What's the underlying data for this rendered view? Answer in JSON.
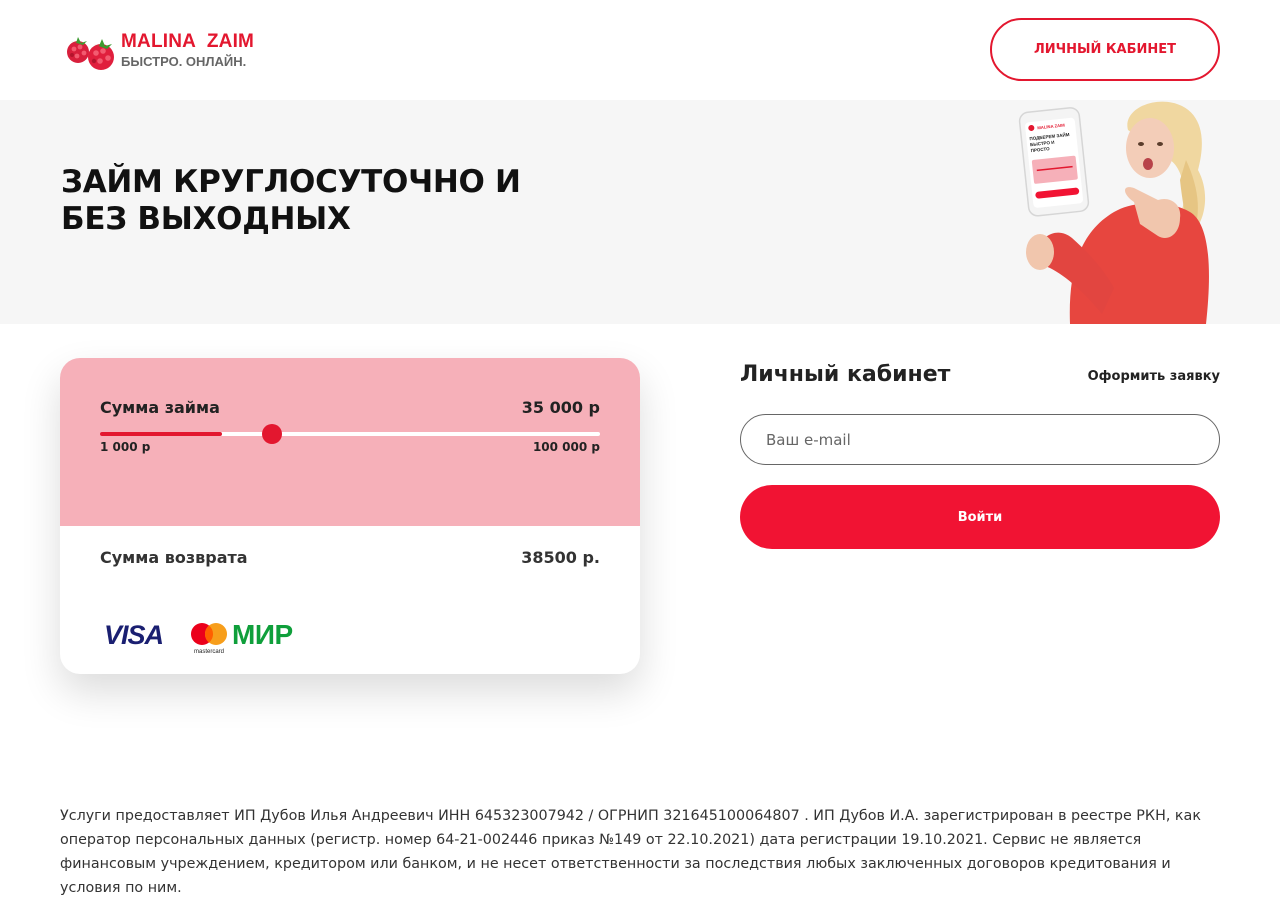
{
  "header": {
    "brand_name": "MALINA ZAIM",
    "brand_tagline": "БЫСТРО. ОНЛАЙН.",
    "cabinet_button": "ЛИЧНЫЙ КАБИНЕТ"
  },
  "hero": {
    "title": "ЗАЙМ КРУГЛОСУТОЧНО И БЕЗ ВЫХОДНЫХ",
    "image": "woman-with-phone-illustration",
    "phone_screen": {
      "brand": "MALINA ZAIM",
      "text": "ПОДБЕРЕМ ЗАЙМ БЫСТРО И ПРОСТО"
    }
  },
  "calculator": {
    "loan_label": "Сумма займа",
    "loan_value": "35 000 р",
    "slider": {
      "min_label": "1 000 р",
      "max_label": "100 000 р",
      "min": 1000,
      "max": 100000,
      "value": 35000
    },
    "return_label": "Сумма возврата",
    "return_value": "38500 р.",
    "payment_logos": {
      "visa": "VISA",
      "mastercard": "mastercard",
      "mir": "МИР"
    }
  },
  "login": {
    "title": "Личный кабинет",
    "apply_link": "Оформить заявку",
    "email_placeholder": "Ваш e-mail",
    "email_value": "",
    "submit_label": "Войти"
  },
  "footer": {
    "note": "Услуги предоставляет ИП Дубов Илья Андреевич ИНН 645323007942 / ОГРНИП 321645100064807 . ИП Дубов И.А. зарегистрирован в реестре РКН, как оператор персональных данных (регистр. номер 64-21-002446 приказ №149 от 22.10.2021) дата регистрации 19.10.2021. Сервис не является финансовым учреждением, кредитором или банком, и не несет ответственности за последствия любых заключенных договоров кредитования и условия по ним."
  },
  "colors": {
    "accent": "#e3172f",
    "button": "#f11333",
    "calc_top": "#f6b0b9",
    "hero_bg": "#f6f6f6",
    "visa": "#1a1f71",
    "mir": "#0f9f3b"
  }
}
